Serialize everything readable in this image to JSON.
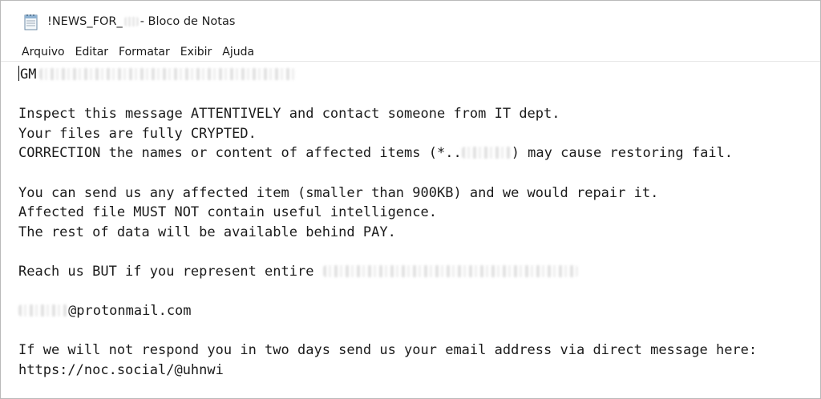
{
  "window": {
    "title_prefix": "!NEWS_FOR_",
    "title_suffix": "- Bloco de Notas",
    "icon": "notepad-icon"
  },
  "menu": {
    "items": [
      "Arquivo",
      "Editar",
      "Formatar",
      "Exibir",
      "Ajuda"
    ]
  },
  "document": {
    "line1_prefix": "GM",
    "line2": "Inspect this message ATTENTIVELY and contact someone from IT dept.",
    "line3": "Your files are fully CRYPTED.",
    "line4_before": "CORRECTION the names or content of affected items (*..",
    "line4_after": ") may cause restoring fail.",
    "line5": "You can send us any affected item (smaller than 900KB) and we would repair it.",
    "line6": "Affected file MUST NOT contain useful intelligence.",
    "line7": "The rest of data will be available behind PAY.",
    "line8_before": "Reach us BUT if you represent entire",
    "line9_after": "@protonmail.com",
    "line10": "If we will not respond you in two days send us your email address via direct message here:",
    "line11": "https://noc.social/@uhnwi"
  }
}
